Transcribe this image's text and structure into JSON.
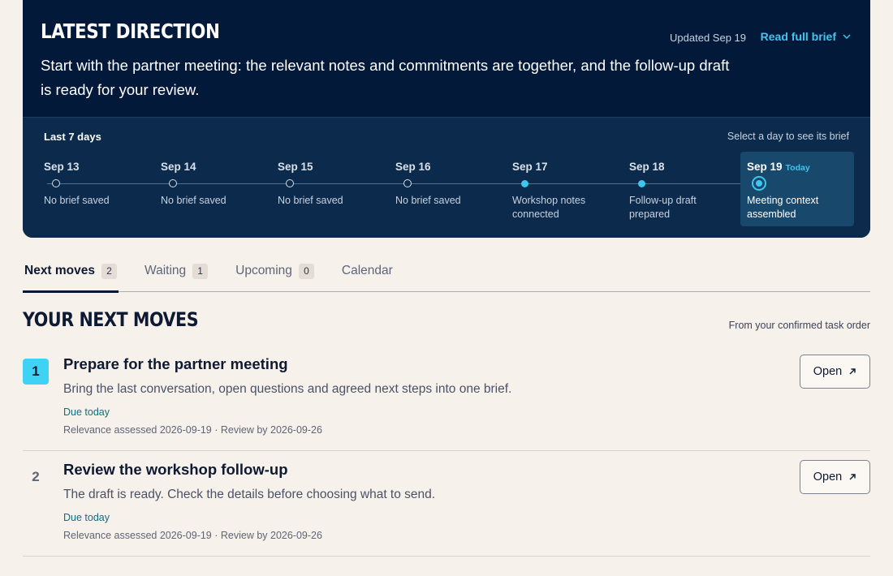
{
  "hero": {
    "title": "LATEST DIRECTION",
    "updated": "Updated Sep 19",
    "read_full_brief": "Read full brief",
    "body": "Start with the partner meeting: the relevant notes and commitments are together, and the follow-up draft is ready for your review."
  },
  "timeline": {
    "title": "Last 7 days",
    "hint": "Select a day to see its brief",
    "today_label": "Today",
    "days": [
      {
        "date": "Sep 13",
        "desc": "No brief saved",
        "state": "empty"
      },
      {
        "date": "Sep 14",
        "desc": "No brief saved",
        "state": "empty"
      },
      {
        "date": "Sep 15",
        "desc": "No brief saved",
        "state": "empty"
      },
      {
        "date": "Sep 16",
        "desc": "No brief saved",
        "state": "empty"
      },
      {
        "date": "Sep 17",
        "desc": "Workshop notes connected",
        "state": "filled"
      },
      {
        "date": "Sep 18",
        "desc": "Follow-up draft prepared",
        "state": "filled"
      },
      {
        "date": "Sep 19",
        "desc": "Meeting context assembled",
        "state": "current"
      }
    ]
  },
  "tabs": [
    {
      "label": "Next moves",
      "count": "2",
      "active": true
    },
    {
      "label": "Waiting",
      "count": "1",
      "active": false
    },
    {
      "label": "Upcoming",
      "count": "0",
      "active": false
    },
    {
      "label": "Calendar",
      "count": null,
      "active": false
    }
  ],
  "next_moves": {
    "title": "YOUR NEXT MOVES",
    "note": "From your confirmed task order",
    "items": [
      {
        "number": "1",
        "title": "Prepare for the partner meeting",
        "desc": "Bring the last conversation, open questions and agreed next steps into one brief.",
        "due": "Due today",
        "meta": "Relevance assessed 2026-09-19 · Review by 2026-09-26",
        "open_label": "Open"
      },
      {
        "number": "2",
        "title": "Review the workshop follow-up",
        "desc": "The draft is ready. Check the details before choosing what to send.",
        "due": "Due today",
        "meta": "Relevance assessed 2026-09-19 · Review by 2026-09-26",
        "open_label": "Open"
      }
    ]
  },
  "colors": {
    "hero_bg": "#03193a",
    "timeline_bg": "#0b2a4c",
    "accent": "#3fc6ec",
    "page_bg": "#f7f1eb"
  }
}
